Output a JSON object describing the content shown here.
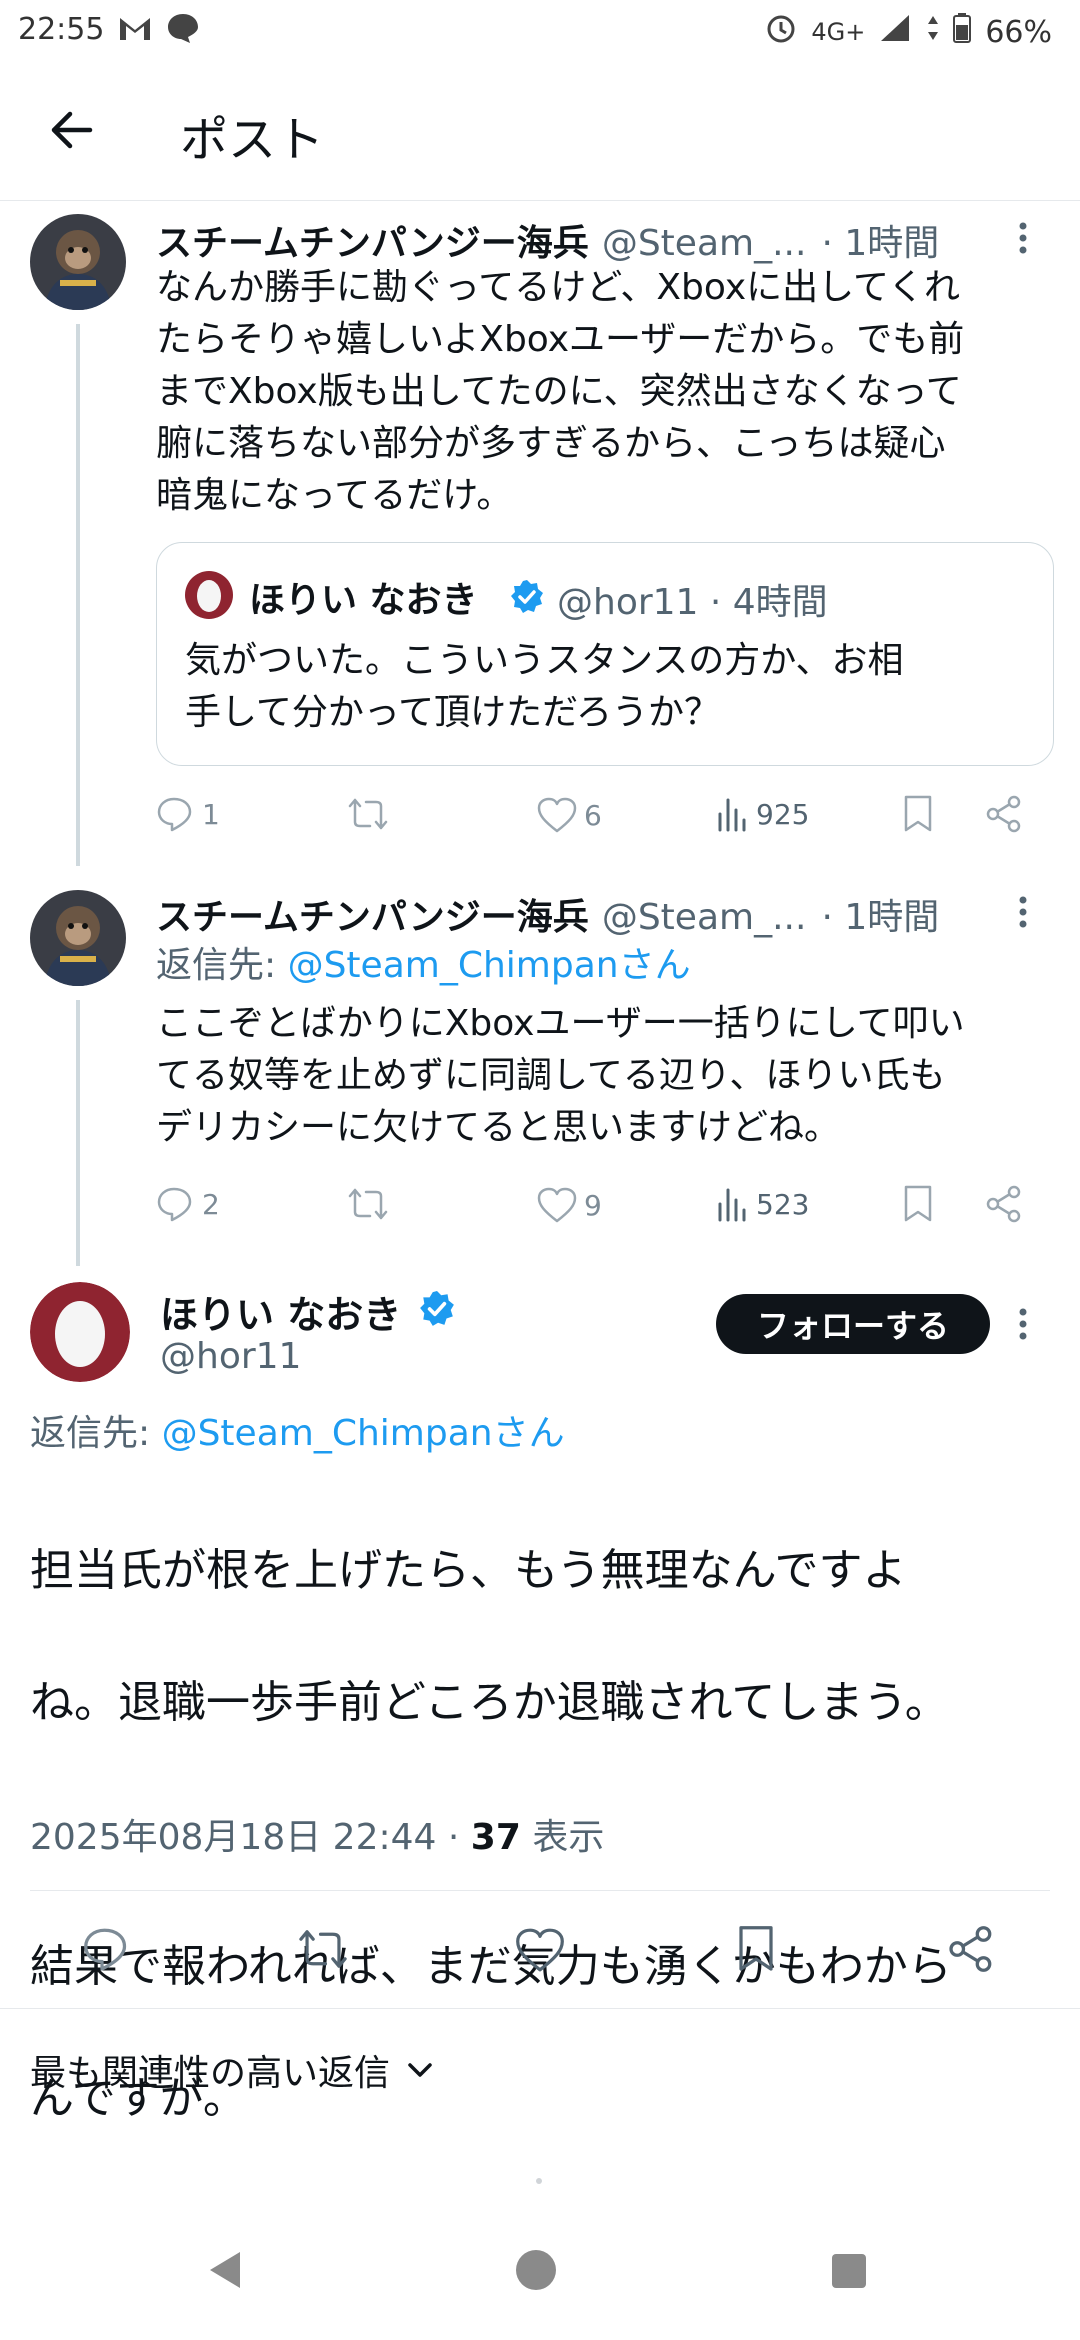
{
  "status_bar": {
    "time": "22:55",
    "network": "4G+",
    "battery": "66%"
  },
  "header": {
    "title": "ポスト"
  },
  "reply1": {
    "name": "スチームチンパンジー海兵",
    "handle": "@Steam_...",
    "time": "· 1時間",
    "text_lines": [
      "なんか勝手に勘ぐってるけど、Xboxに出してくれ",
      "たらそりゃ嬉しいよXboxユーザーだから。でも前",
      "までXbox版も出してたのに、突然出さなくなって",
      "腑に落ちない部分が多すぎるから、こっちは疑心",
      "暗鬼になってるだけ。"
    ],
    "quote": {
      "name": "ほりい なおき",
      "meta": "@hor11 · 4時間",
      "text_lines": [
        "気がついた。こういうスタンスの方か、お相",
        "手して分かって頂けただろうか？"
      ]
    },
    "stats": {
      "replies": "1",
      "reposts": "",
      "likes": "6",
      "views": "925"
    }
  },
  "reply2": {
    "name": "スチームチンパンジー海兵",
    "handle": "@Steam_...",
    "time": "· 1時間",
    "reply_to_label": "返信先: ",
    "reply_to_user": "@Steam_Chimpanさん",
    "text_lines": [
      "ここぞとばかりにXboxユーザー一括りにして叩い",
      "てる奴等を止めずに同調してる辺り、ほりい氏も",
      "デリカシーに欠けてると思いますけどね。"
    ],
    "stats": {
      "replies": "2",
      "reposts": "",
      "likes": "9",
      "views": "523"
    }
  },
  "main_post": {
    "name": "ほりい なおき",
    "handle": "@hor11",
    "follow_label": "フォローする",
    "reply_to_label": "返信先: ",
    "reply_to_user": "@Steam_Chimpanさん",
    "text_lines": [
      "担当氏が根を上げたら、もう無理なんですよ",
      "ね。退職一歩手前どころか退職されてしまう。",
      "",
      "結果で報われれば、まだ気力も湧くかもわから",
      "んですが。"
    ],
    "timestamp": "2025年08月18日 22:44 · ",
    "view_count": "37",
    "view_label": " 表示"
  },
  "replies_sort": {
    "label": "最も関連性の高い返信"
  },
  "colors": {
    "link": "#1d9bf0",
    "verified": "#1d9bf0",
    "text": "#0f1419",
    "muted": "#536471"
  }
}
